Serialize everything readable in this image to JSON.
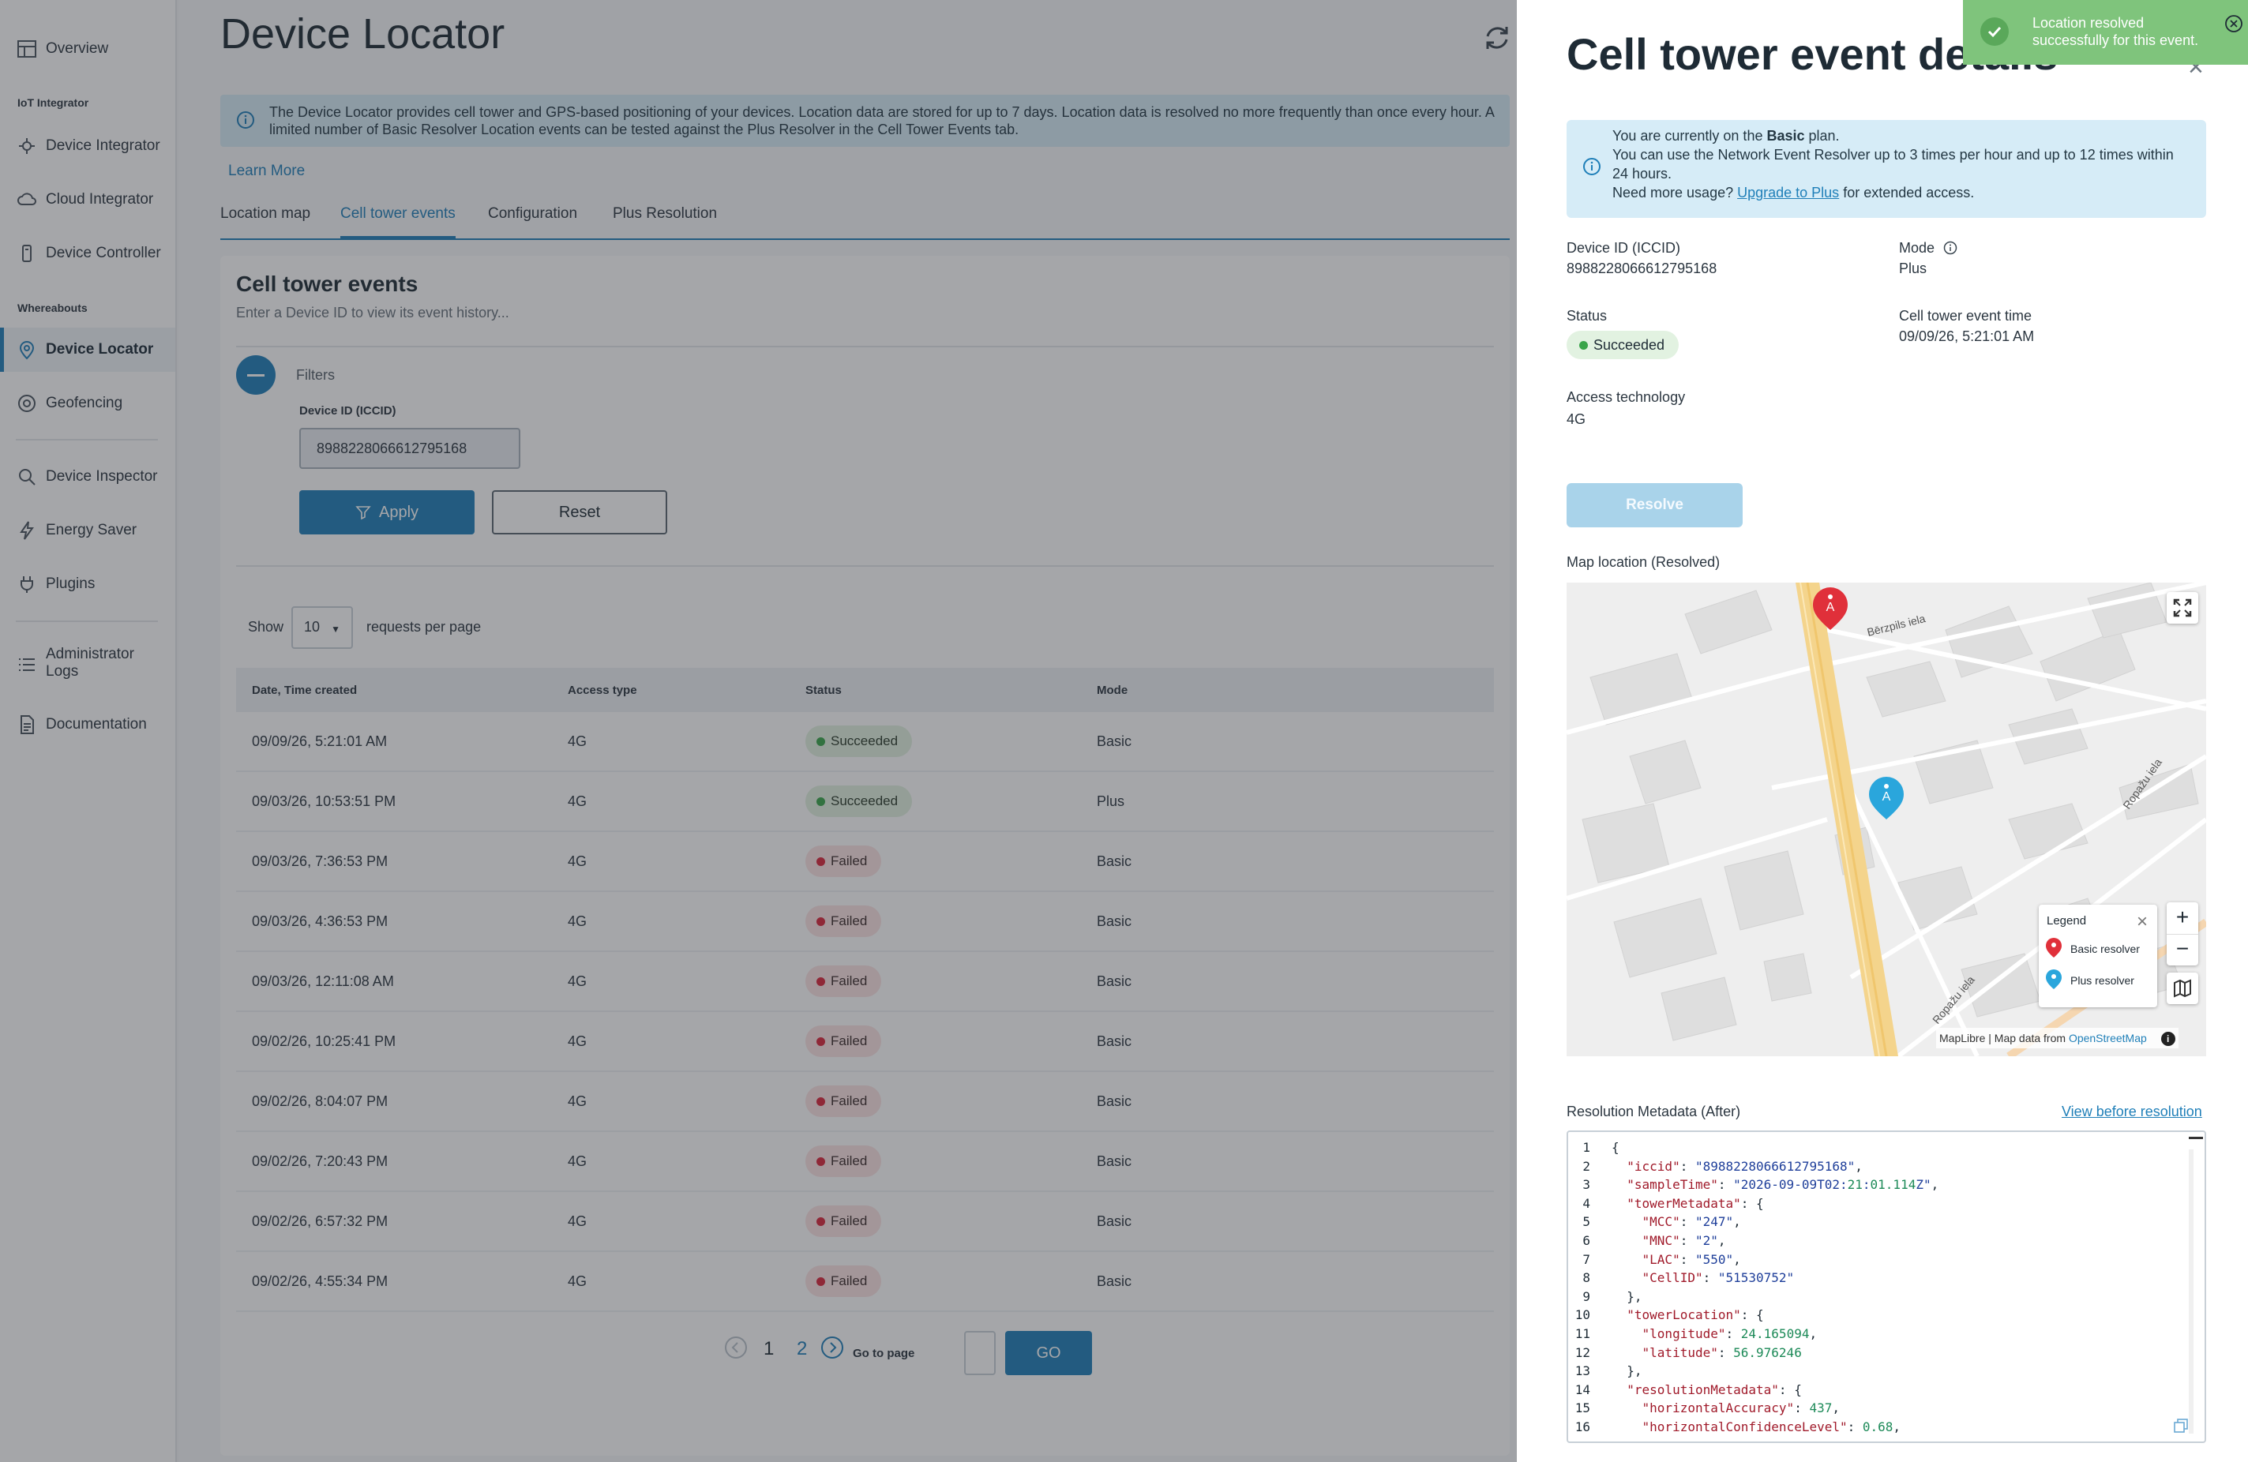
{
  "sidebar": {
    "overview": "Overview",
    "group_iot": "IoT Integrator",
    "device_integrator": "Device Integrator",
    "cloud_integrator": "Cloud Integrator",
    "device_controller": "Device Controller",
    "group_whereabouts": "Whereabouts",
    "device_locator": "Device Locator",
    "geofencing": "Geofencing",
    "device_inspector": "Device Inspector",
    "energy_saver": "Energy Saver",
    "plugins": "Plugins",
    "admin_logs_1": "Administrator",
    "admin_logs_2": "Logs",
    "documentation": "Documentation"
  },
  "main": {
    "title": "Device Locator",
    "banner": "The Device Locator provides cell tower and GPS-based positioning of your devices. Location data are stored for up to 7 days. Location data is resolved no more frequently than once every hour. A limited number of Basic Resolver Location events can be tested against the Plus Resolver in the Cell Tower Events tab.",
    "learn_more": "Learn More",
    "tabs": [
      "Location map",
      "Cell tower events",
      "Configuration",
      "Plus Resolution"
    ],
    "active_tab": "Cell tower events",
    "card_title": "Cell tower events",
    "card_subtitle": "Enter a Device ID to view its event history...",
    "filters_label": "Filters",
    "device_id_label": "Device ID (ICCID)",
    "device_id_value": "8988228066612795168",
    "apply": "Apply",
    "reset": "Reset",
    "show": "Show",
    "page_size": "10",
    "per_page": "requests per page",
    "columns": [
      "Date, Time created",
      "Access type",
      "Status",
      "Mode"
    ],
    "rows": [
      {
        "date": "09/09/26, 5:21:01 AM",
        "access": "4G",
        "status": "Succeeded",
        "mode": "Basic"
      },
      {
        "date": "09/03/26, 10:53:51 PM",
        "access": "4G",
        "status": "Succeeded",
        "mode": "Plus"
      },
      {
        "date": "09/03/26, 7:36:53 PM",
        "access": "4G",
        "status": "Failed",
        "mode": "Basic"
      },
      {
        "date": "09/03/26, 4:36:53 PM",
        "access": "4G",
        "status": "Failed",
        "mode": "Basic"
      },
      {
        "date": "09/03/26, 12:11:08 AM",
        "access": "4G",
        "status": "Failed",
        "mode": "Basic"
      },
      {
        "date": "09/02/26, 10:25:41 PM",
        "access": "4G",
        "status": "Failed",
        "mode": "Basic"
      },
      {
        "date": "09/02/26, 8:04:07 PM",
        "access": "4G",
        "status": "Failed",
        "mode": "Basic"
      },
      {
        "date": "09/02/26, 7:20:43 PM",
        "access": "4G",
        "status": "Failed",
        "mode": "Basic"
      },
      {
        "date": "09/02/26, 6:57:32 PM",
        "access": "4G",
        "status": "Failed",
        "mode": "Basic"
      },
      {
        "date": "09/02/26, 4:55:34 PM",
        "access": "4G",
        "status": "Failed",
        "mode": "Basic"
      }
    ],
    "pages": [
      "1",
      "2"
    ],
    "go_to_page": "Go to page",
    "go": "GO"
  },
  "drawer": {
    "title": "Cell tower event details",
    "plan_line1_pre": "You are currently on the ",
    "plan_name": "Basic",
    "plan_line1_post": " plan.",
    "plan_line2": "You can use the Network Event Resolver up to 3 times per hour and up to 12 times within 24 hours.",
    "plan_line3_pre": "Need more usage? ",
    "upgrade_link": "Upgrade to Plus",
    "plan_line3_post": " for extended access.",
    "device_id_label": "Device ID (ICCID)",
    "device_id_value": "8988228066612795168",
    "mode_label": "Mode",
    "mode_value": "Plus",
    "status_label": "Status",
    "status_value": "Succeeded",
    "event_time_label": "Cell tower event time",
    "event_time_value": "09/09/26, 5:21:01 AM",
    "access_label": "Access technology",
    "access_value": "4G",
    "resolve": "Resolve",
    "map_label": "Map location (Resolved)",
    "map": {
      "street_1": "Bērzpils iela",
      "street_2": "Ropažu iela",
      "street_3": "Ropažu iela",
      "legend_title": "Legend",
      "legend_basic": "Basic resolver",
      "legend_plus": "Plus resolver",
      "attribution_pre": "MapLibre | Map data from ",
      "attribution_link": "OpenStreetMap",
      "basic_color": "#e0303a",
      "plus_color": "#2aa6dc"
    },
    "meta_label": "Resolution Metadata (After)",
    "view_before": "View before resolution",
    "code_lines": [
      "{",
      "  \"iccid\": \"8988228066612795168\",",
      "  \"sampleTime\": \"2026-09-09T02:21:01.114Z\",",
      "  \"towerMetadata\": {",
      "    \"MCC\": \"247\",",
      "    \"MNC\": \"2\",",
      "    \"LAC\": \"550\",",
      "    \"CellID\": \"51530752\"",
      "  },",
      "  \"towerLocation\": {",
      "    \"longitude\": 24.165094,",
      "    \"latitude\": 56.976246",
      "  },",
      "  \"resolutionMetadata\": {",
      "    \"horizontalAccuracy\": 437,",
      "    \"horizontalConfidenceLevel\": 0.68,"
    ]
  },
  "toast": {
    "line1": "Location resolved",
    "line2": "successfully for this event."
  },
  "colors": {
    "accent": "#1f7fb8",
    "success": "#3aa54a",
    "failed": "#d9263b"
  }
}
